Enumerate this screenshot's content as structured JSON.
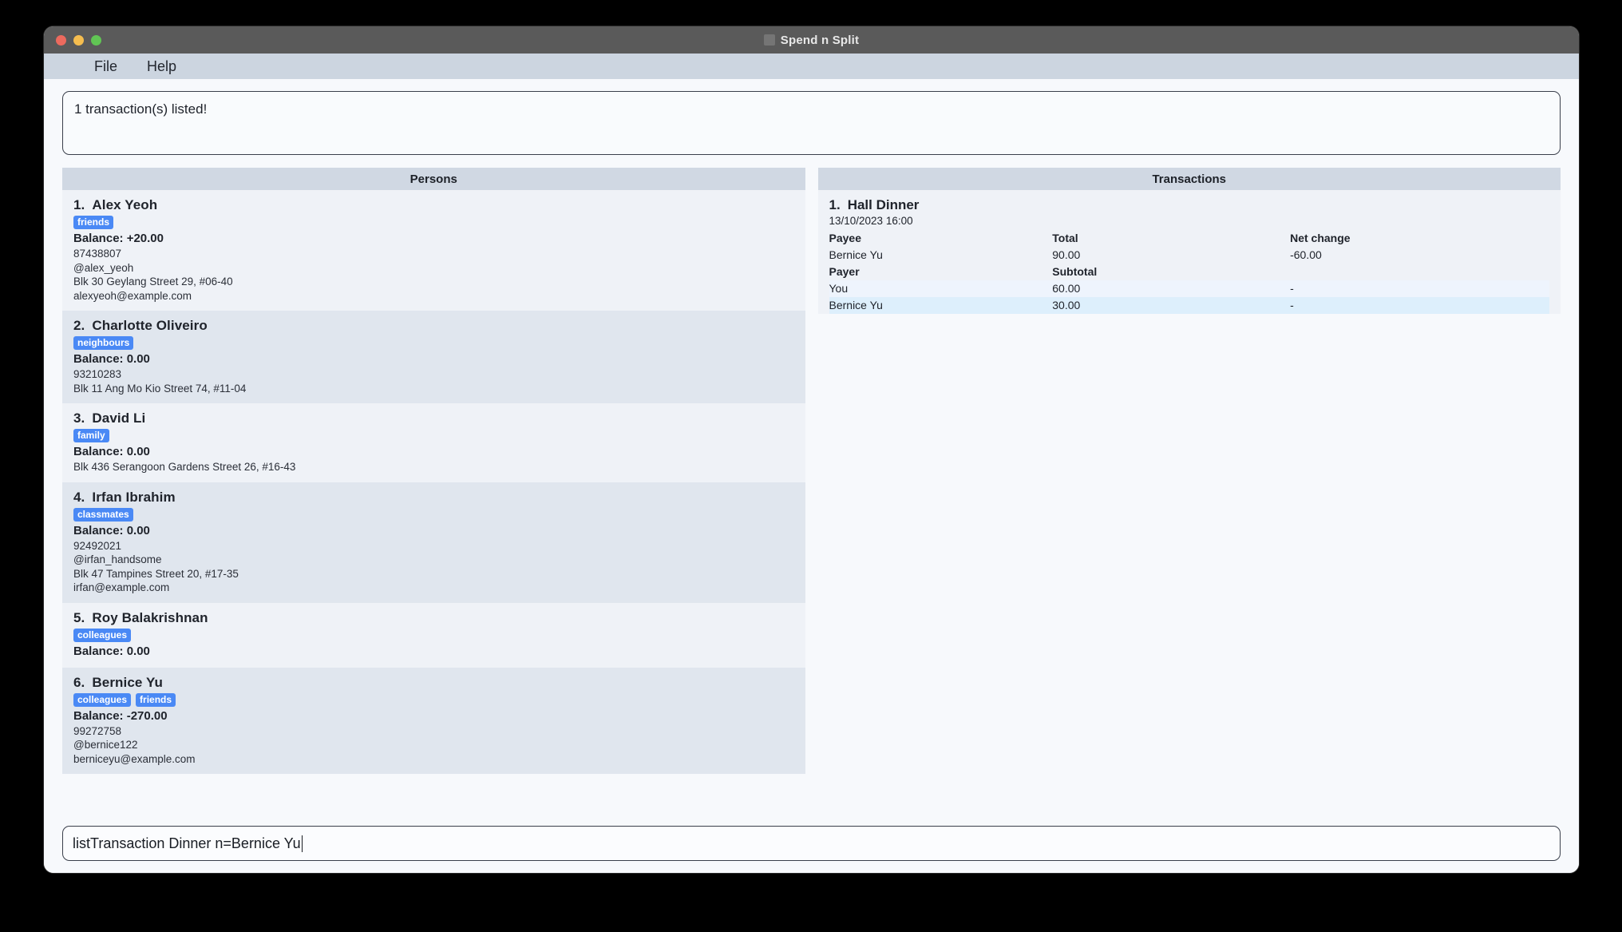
{
  "window": {
    "title": "Spend n Split",
    "title_icon": "app-icon",
    "traffic_lights": [
      "close",
      "minimize",
      "maximize"
    ]
  },
  "menubar": {
    "items": [
      {
        "label": "File"
      },
      {
        "label": "Help"
      }
    ]
  },
  "result_display": {
    "message": "1 transaction(s) listed!"
  },
  "persons_panel": {
    "header": "Persons",
    "items": [
      {
        "index": "1.",
        "name": "Alex Yeoh",
        "tags": [
          "friends"
        ],
        "balance": "Balance: +20.00",
        "details": [
          "87438807",
          "@alex_yeoh",
          "Blk 30 Geylang Street 29, #06-40",
          "alexyeoh@example.com"
        ]
      },
      {
        "index": "2.",
        "name": "Charlotte Oliveiro",
        "tags": [
          "neighbours"
        ],
        "balance": "Balance: 0.00",
        "details": [
          "93210283",
          "Blk 11 Ang Mo Kio Street 74, #11-04"
        ]
      },
      {
        "index": "3.",
        "name": "David Li",
        "tags": [
          "family"
        ],
        "balance": "Balance: 0.00",
        "details": [
          "Blk 436 Serangoon Gardens Street 26, #16-43"
        ]
      },
      {
        "index": "4.",
        "name": "Irfan Ibrahim",
        "tags": [
          "classmates"
        ],
        "balance": "Balance: 0.00",
        "details": [
          "92492021",
          "@irfan_handsome",
          "Blk 47 Tampines Street 20, #17-35",
          "irfan@example.com"
        ]
      },
      {
        "index": "5.",
        "name": "Roy Balakrishnan",
        "tags": [
          "colleagues"
        ],
        "balance": "Balance: 0.00",
        "details": []
      },
      {
        "index": "6.",
        "name": "Bernice Yu",
        "tags": [
          "colleagues",
          "friends"
        ],
        "balance": "Balance: -270.00",
        "details": [
          "99272758",
          "@bernice122",
          "berniceyu@example.com"
        ]
      }
    ]
  },
  "transactions_panel": {
    "header": "Transactions",
    "items": [
      {
        "index": "1.",
        "title": "Hall Dinner",
        "datetime": "13/10/2023 16:00",
        "payee_header": {
          "c1": "Payee",
          "c2": "Total",
          "c3": "Net change"
        },
        "payee_row": {
          "c1": "Bernice Yu",
          "c2": "90.00",
          "c3": "-60.00"
        },
        "payer_header": {
          "c1": "Payer",
          "c2": "Subtotal",
          "c3": ""
        },
        "payer_rows": [
          {
            "c1": "You",
            "c2": "60.00",
            "c3": "-"
          },
          {
            "c1": "Bernice Yu",
            "c2": "30.00",
            "c3": "-"
          }
        ]
      }
    ]
  },
  "command_box": {
    "value": "listTransaction Dinner n=Bernice Yu",
    "placeholder": "Enter command here..."
  },
  "colors": {
    "titlebar": "#5a5a5a",
    "menubar": "#ccd5e0",
    "panel_header": "#d0d8e3",
    "row_odd": "#eff2f7",
    "row_even": "#e0e6ee",
    "tag_badge": "#4a89f5",
    "txn_row_a": "#eef4fd",
    "txn_row_b": "#ddeffc",
    "desktop": "#000000"
  }
}
